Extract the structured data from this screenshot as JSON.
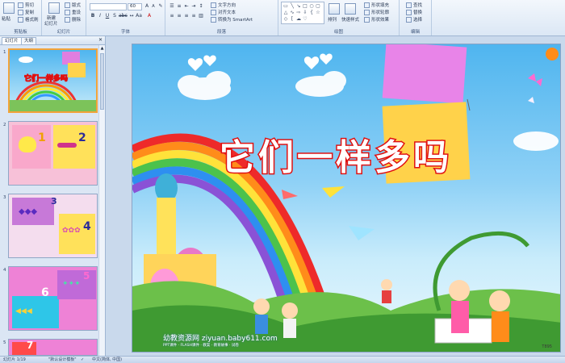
{
  "ribbon": {
    "groups": {
      "clipboard": "剪贴板",
      "slides": "幻灯片",
      "font": "字体",
      "paragraph": "段落",
      "drawing": "绘图",
      "editing": "编辑"
    },
    "clipboard": {
      "paste": "粘贴",
      "cut": "剪切",
      "copy": "复制",
      "format_painter": "格式刷"
    },
    "slides": {
      "new_slide": "新建",
      "new_slide2": "幻灯片",
      "layout": "版式",
      "reset": "重设",
      "delete": "删除"
    },
    "font": {
      "font_name": "",
      "font_size": "60"
    },
    "paragraph": {
      "text_direction": "文字方向",
      "align_text": "对齐文本",
      "smartart": "转换为 SmartArt"
    },
    "drawing": {
      "arrange": "排列",
      "quick_styles": "快速样式",
      "shape_fill": "形状填充",
      "shape_outline": "形状轮廓",
      "shape_effects": "形状效果"
    },
    "editing": {
      "find": "查找",
      "replace": "替换",
      "select": "选择"
    }
  },
  "pane": {
    "tabs": [
      "幻灯片",
      "大纲"
    ],
    "slides": [
      {
        "num": "1",
        "title": "它们一样多吗"
      },
      {
        "num": "2",
        "label_a": "1",
        "label_b": "2"
      },
      {
        "num": "3",
        "label_a": "3",
        "label_b": "4"
      },
      {
        "num": "4",
        "label_a": "5",
        "label_b": "6"
      },
      {
        "num": "5",
        "label_a": "7"
      }
    ]
  },
  "slide": {
    "title": "它们一样多吗",
    "watermark": "幼教资源网 ziyuan.baby611.com",
    "watermark_sub": "PPT课件 · FLASH课件 · 教案 · 教育故事 · 试卷",
    "corner": "T895"
  },
  "status": {
    "slide_info": "幻灯片 1/19",
    "theme": "\"默认设计模板\"",
    "language": "中文(简体, 中国)"
  }
}
